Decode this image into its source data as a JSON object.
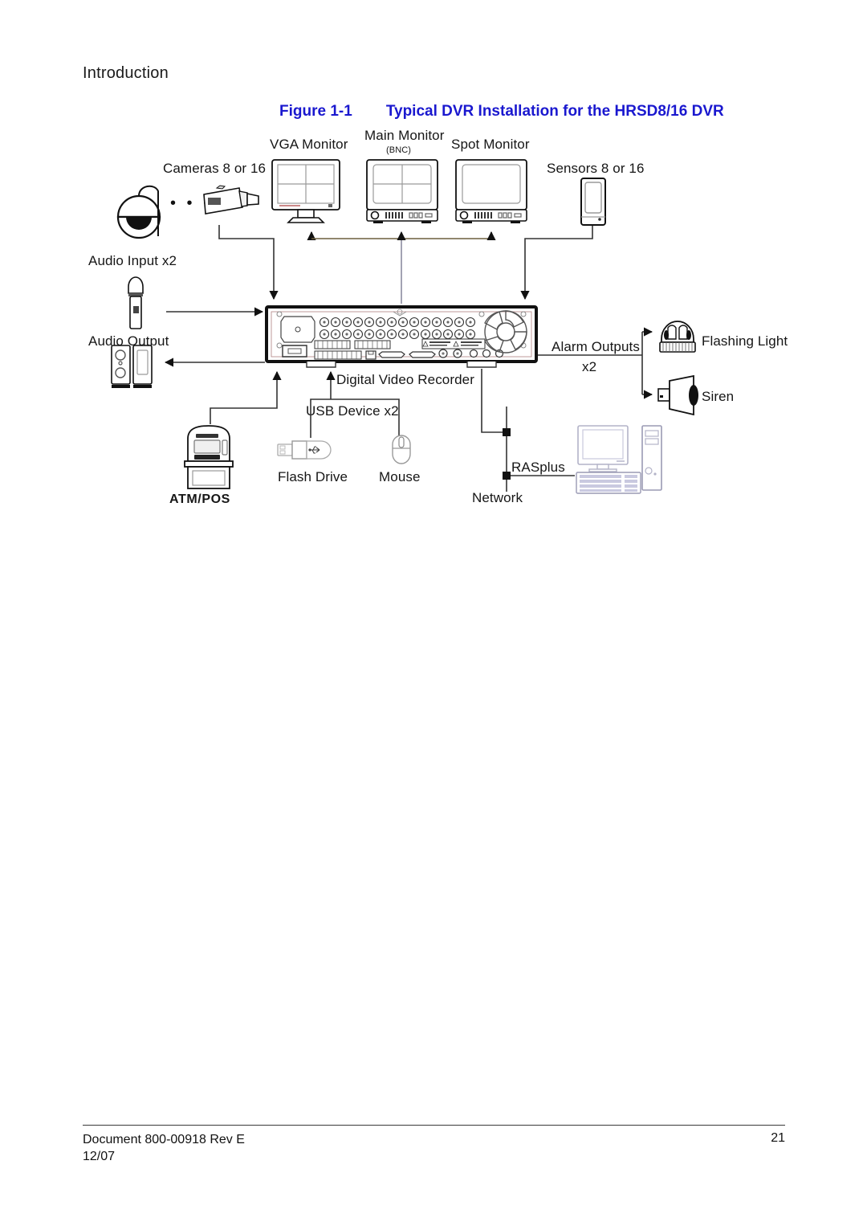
{
  "page": {
    "section_heading": "Introduction",
    "figure": {
      "number": "Figure 1-1",
      "title": "Typical DVR Installation for the HRSD8/16 DVR",
      "color": "#1a18cf"
    }
  },
  "diagram": {
    "type": "system-installation-block-diagram",
    "labels": {
      "cameras": "Cameras 8 or 16",
      "vga_monitor": "VGA Monitor",
      "main_monitor": "Main Monitor",
      "main_monitor_sub": "(BNC)",
      "spot_monitor": "Spot Monitor",
      "sensors": "Sensors 8 or 16",
      "audio_input": "Audio Input x2",
      "audio_output": "Audio Output",
      "dvr": "Digital Video Recorder",
      "alarm_outputs": "Alarm Outputs",
      "alarm_outputs_qty": "x2",
      "flashing_light": "Flashing Light",
      "siren": "Siren",
      "usb_device": "USB Device x2",
      "flash_drive": "Flash Drive",
      "mouse": "Mouse",
      "atm_pos": "ATM/POS",
      "rasplus": "RASplus",
      "network": "Network",
      "camera_ellipsis": "• • •"
    },
    "nodes": [
      {
        "id": "dome-camera",
        "label": "Cameras 8 or 16"
      },
      {
        "id": "box-camera",
        "label": "Cameras 8 or 16"
      },
      {
        "id": "vga-monitor",
        "label": "VGA Monitor"
      },
      {
        "id": "main-monitor",
        "label": "Main Monitor (BNC)"
      },
      {
        "id": "spot-monitor",
        "label": "Spot Monitor"
      },
      {
        "id": "sensor",
        "label": "Sensors 8 or 16"
      },
      {
        "id": "microphone",
        "label": "Audio Input x2"
      },
      {
        "id": "speakers",
        "label": "Audio Output"
      },
      {
        "id": "dvr",
        "label": "Digital Video Recorder"
      },
      {
        "id": "flashing-light",
        "label": "Flashing Light"
      },
      {
        "id": "siren",
        "label": "Siren"
      },
      {
        "id": "flash-drive",
        "label": "Flash Drive"
      },
      {
        "id": "mouse",
        "label": "Mouse"
      },
      {
        "id": "atm-pos",
        "label": "ATM/POS"
      },
      {
        "id": "pc",
        "label": "RASplus"
      }
    ],
    "connections": [
      {
        "from": "box-camera",
        "to": "dvr",
        "label": ""
      },
      {
        "from": "dvr",
        "to": "vga-monitor",
        "label": ""
      },
      {
        "from": "dvr",
        "to": "main-monitor",
        "label": ""
      },
      {
        "from": "dvr",
        "to": "spot-monitor",
        "label": ""
      },
      {
        "from": "sensor",
        "to": "dvr",
        "label": ""
      },
      {
        "from": "microphone",
        "to": "dvr",
        "label": "Audio Input x2"
      },
      {
        "from": "dvr",
        "to": "speakers",
        "label": "Audio Output"
      },
      {
        "from": "dvr",
        "to": "flashing-light",
        "label": "Alarm Outputs x2"
      },
      {
        "from": "dvr",
        "to": "siren",
        "label": "Alarm Outputs x2"
      },
      {
        "from": "flash-drive",
        "to": "dvr",
        "label": "USB Device x2"
      },
      {
        "from": "mouse",
        "to": "dvr",
        "label": "USB Device x2"
      },
      {
        "from": "atm-pos",
        "to": "dvr",
        "label": ""
      },
      {
        "from": "dvr",
        "to": "pc",
        "label": "RASplus / Network"
      }
    ]
  },
  "footer": {
    "document": "Document 800-00918 Rev E\n12/07",
    "page_number": "21"
  }
}
